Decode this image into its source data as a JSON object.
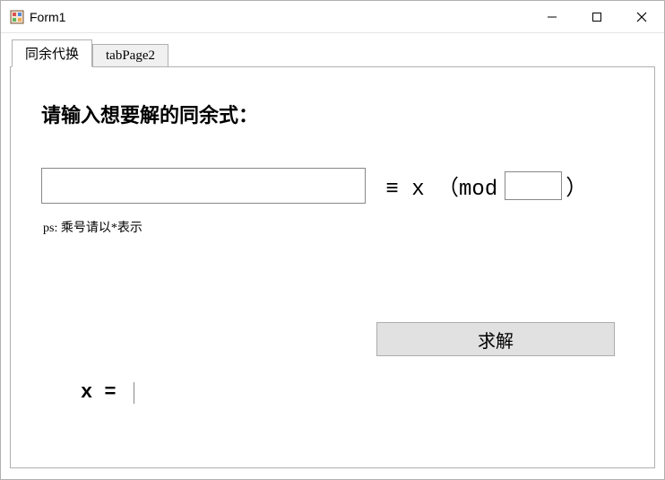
{
  "window": {
    "title": "Form1"
  },
  "tabs": {
    "tab1_label": "同余代换",
    "tab2_label": "tabPage2"
  },
  "page": {
    "heading": "请输入想要解的同余式：",
    "expr_value": "",
    "equiv_text": " ≡ x （mod",
    "mod_value": "",
    "close_paren": "）",
    "hint": "ps: 乘号请以*表示",
    "solve_label": "求解",
    "result_label": "x = ",
    "result_value": ""
  }
}
